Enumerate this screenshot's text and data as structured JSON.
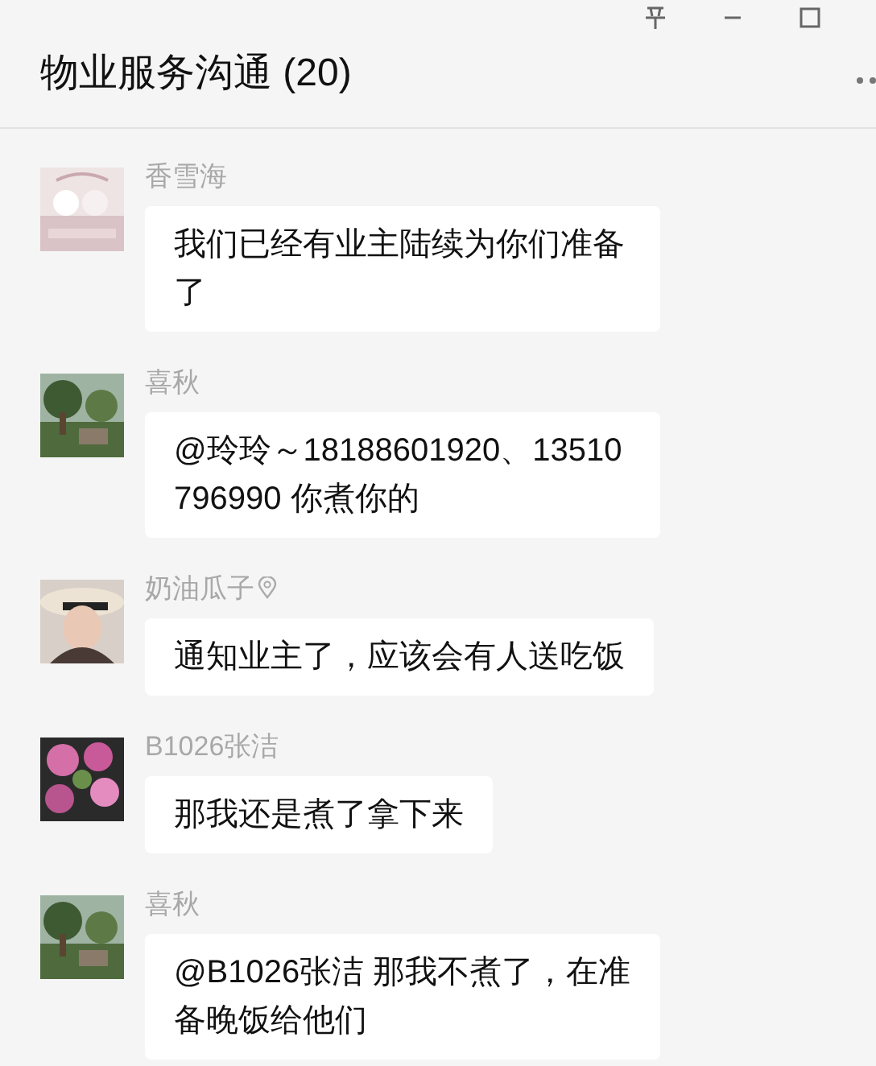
{
  "window": {
    "title": "物业服务沟通 (20)"
  },
  "messages": [
    {
      "sender": "香雪海",
      "badge": false,
      "text": "我们已经有业主陆续为你们准备了"
    },
    {
      "sender": "喜秋",
      "badge": false,
      "text": "@玲玲～18188601920、13510796990 你煮你的"
    },
    {
      "sender": "奶油瓜子",
      "badge": true,
      "text": "通知业主了，应该会有人送吃饭"
    },
    {
      "sender": "B1026张洁",
      "badge": false,
      "text": "那我还是煮了拿下来"
    },
    {
      "sender": "喜秋",
      "badge": false,
      "text": "@B1026张洁 那我不煮了，在准备晚饭给他们"
    }
  ]
}
